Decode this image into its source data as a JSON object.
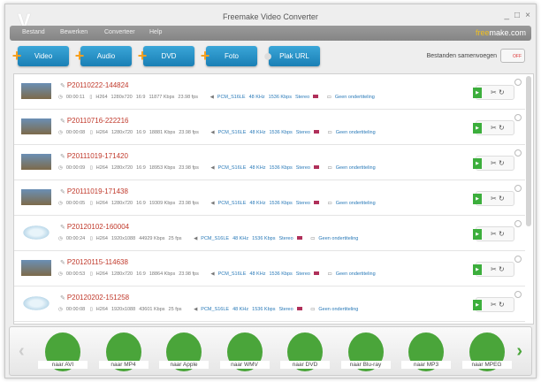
{
  "window": {
    "title": "Freemake Video Converter",
    "minimize": "_",
    "maximize": "□",
    "close": "×"
  },
  "menu": [
    "Bestand",
    "Bewerken",
    "Converteer",
    "Help"
  ],
  "brand": {
    "accent": "free",
    "rest": "make.com"
  },
  "toolbar": [
    "Video",
    "Audio",
    "DVD",
    "Foto",
    "Plak URL"
  ],
  "merge": {
    "label": "Bestanden samenvoegen",
    "state": "OFF"
  },
  "files": [
    {
      "name": "P20110222-144824",
      "duration": "00:00:11",
      "codec": "H264",
      "res": "1280x720",
      "aspect": "16:9",
      "bitrate": "11877 Kbps",
      "fps": "23.98 fps",
      "audio": "PCM_S16LE",
      "khz": "48 KHz",
      "abitrate": "1536 Kbps",
      "channels": "Stereo",
      "subs": "Geen ondertiteling",
      "thumb": "photo"
    },
    {
      "name": "P20110716-222216",
      "duration": "00:00:08",
      "codec": "H264",
      "res": "1280x720",
      "aspect": "16:9",
      "bitrate": "18881 Kbps",
      "fps": "23.98 fps",
      "audio": "PCM_S16LE",
      "khz": "48 KHz",
      "abitrate": "1536 Kbps",
      "channels": "Stereo",
      "subs": "Geen ondertiteling",
      "thumb": "photo"
    },
    {
      "name": "P20111019-171420",
      "duration": "00:00:09",
      "codec": "H264",
      "res": "1280x720",
      "aspect": "16:9",
      "bitrate": "18953 Kbps",
      "fps": "23.98 fps",
      "audio": "PCM_S16LE",
      "khz": "48 KHz",
      "abitrate": "1536 Kbps",
      "channels": "Stereo",
      "subs": "Geen ondertiteling",
      "thumb": "photo"
    },
    {
      "name": "P20111019-171438",
      "duration": "00:00:05",
      "codec": "H264",
      "res": "1280x720",
      "aspect": "16:9",
      "bitrate": "19309 Kbps",
      "fps": "23.98 fps",
      "audio": "PCM_S16LE",
      "khz": "48 KHz",
      "abitrate": "1536 Kbps",
      "channels": "Stereo",
      "subs": "Geen ondertiteling",
      "thumb": "photo"
    },
    {
      "name": "P20120102-160004",
      "duration": "00:00:24",
      "codec": "H264",
      "res": "1920x1088",
      "aspect": "",
      "bitrate": "44929 Kbps",
      "fps": "25 fps",
      "audio": "PCM_S16LE",
      "khz": "48 KHz",
      "abitrate": "1536 Kbps",
      "channels": "Stereo",
      "subs": "Geen ondertiteling",
      "thumb": "disc"
    },
    {
      "name": "P20120115-114638",
      "duration": "00:00:53",
      "codec": "H264",
      "res": "1280x720",
      "aspect": "16:9",
      "bitrate": "18864 Kbps",
      "fps": "23.98 fps",
      "audio": "PCM_S16LE",
      "khz": "48 KHz",
      "abitrate": "1536 Kbps",
      "channels": "Stereo",
      "subs": "Geen ondertiteling",
      "thumb": "photo"
    },
    {
      "name": "P20120202-151258",
      "duration": "00:00:08",
      "codec": "H264",
      "res": "1920x1088",
      "aspect": "",
      "bitrate": "43601 Kbps",
      "fps": "25 fps",
      "audio": "PCM_S16LE",
      "khz": "48 KHz",
      "abitrate": "1536 Kbps",
      "channels": "Stereo",
      "subs": "Geen ondertiteling",
      "thumb": "disc"
    }
  ],
  "formats": [
    "naar AVI",
    "naar MP4",
    "naar Apple",
    "naar WMV",
    "naar DVD",
    "naar Blu-ray",
    "naar MP3",
    "naar MPEG"
  ],
  "colors": {
    "accent": "#1a7fb5",
    "filename": "#c0392b",
    "format": "#4aa53a"
  }
}
